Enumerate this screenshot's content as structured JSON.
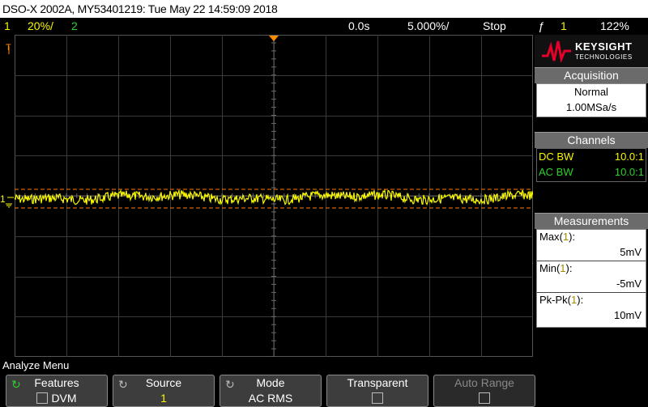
{
  "titlebar": {
    "text": "DSO-X 2002A, MY53401219: Tue May 22 14:59:09 2018"
  },
  "status": {
    "ch1_num": "1",
    "ch1_scale": "20%/",
    "ch2_num": "2",
    "time_offset": "0.0s",
    "timebase": "5.000%/",
    "run_state": "Stop",
    "trig_icon": "ƒ",
    "trig_ch": "1",
    "trig_level": "122%"
  },
  "scope": {
    "ch1_marker": "1",
    "ch1_color": "#f7f700",
    "cursor_color": "#ff7a00",
    "trigger_marker_color": "#ff8c00"
  },
  "brand": {
    "name": "KEYSIGHT",
    "sub": "TECHNOLOGIES",
    "accent": "#e4002b"
  },
  "acquisition": {
    "title": "Acquisition",
    "mode": "Normal",
    "rate": "1.00MSa/s"
  },
  "channels": {
    "title": "Channels",
    "items": [
      {
        "label": "DC BW",
        "probe": "10.0:1",
        "color": "#f7f700"
      },
      {
        "label": "AC BW",
        "probe": "10.0:1",
        "color": "#2cd12c"
      }
    ]
  },
  "measurements": {
    "title": "Measurements",
    "items": [
      {
        "name": "Max",
        "ch": "1",
        "value": "5mV"
      },
      {
        "name": "Min",
        "ch": "1",
        "value": "-5mV"
      },
      {
        "name": "Pk-Pk",
        "ch": "1",
        "value": "10mV"
      }
    ]
  },
  "menu": {
    "title": "Analyze Menu",
    "softkeys": [
      {
        "top": "Features",
        "bottom": "DVM",
        "knob": true,
        "knob_active": true,
        "checkbox": true
      },
      {
        "top": "Source",
        "bottom": "1",
        "knob": true,
        "knob_active": false,
        "checkbox": false
      },
      {
        "top": "Mode",
        "bottom": "AC RMS",
        "knob": true,
        "knob_active": false,
        "checkbox": false
      },
      {
        "top": "Transparent",
        "bottom": "",
        "knob": false,
        "checkbox": true
      },
      {
        "top": "Auto Range",
        "bottom": "",
        "knob": false,
        "checkbox": true,
        "disabled": true
      }
    ]
  }
}
